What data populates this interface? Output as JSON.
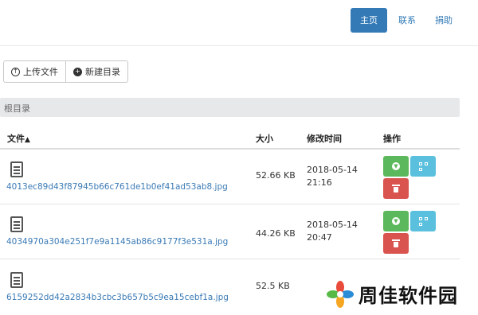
{
  "nav": {
    "items": [
      {
        "label": "主页",
        "active": true
      },
      {
        "label": "联系",
        "active": false
      },
      {
        "label": "捐助",
        "active": false
      }
    ]
  },
  "toolbar": {
    "upload_label": "上传文件",
    "new_dir_label": "新建目录"
  },
  "breadcrumb": {
    "label": "根目录"
  },
  "table": {
    "headers": {
      "file": "文件",
      "size": "大小",
      "modified": "修改时间",
      "actions": "操作"
    },
    "rows": [
      {
        "name": "4013ec89d43f87945b66c761de1b0ef41ad53ab8.jpg",
        "size": "52.66 KB",
        "date": "2018-05-14",
        "time": "21:16"
      },
      {
        "name": "4034970a304e251f7e9a1145ab86c9177f3e531a.jpg",
        "size": "44.26 KB",
        "date": "2018-05-14",
        "time": "20:47"
      },
      {
        "name": "6159252dd42a2834b3cbc3b657b5c9ea15cebf1a.jpg",
        "size": "52.5 KB",
        "date": "",
        "time": ""
      }
    ]
  },
  "watermark": {
    "text": "周佳软件园"
  },
  "colors": {
    "primary": "#337ab7",
    "success": "#5cb85c",
    "info": "#5bc0de",
    "danger": "#d9534f"
  }
}
